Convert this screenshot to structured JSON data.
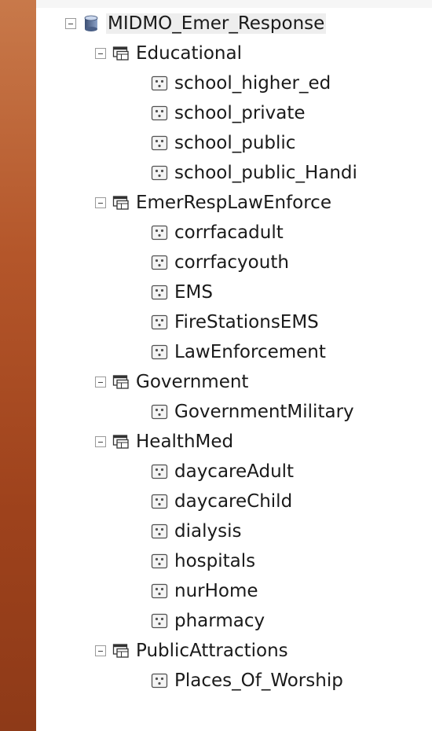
{
  "tree": {
    "root": {
      "label": "MIDMO_Emer_Response",
      "icon": "database-icon"
    },
    "datasets": [
      {
        "label": "Educational",
        "icon": "feature-dataset-icon",
        "classes": [
          "school_higher_ed",
          "school_private",
          "school_public",
          "school_public_Handi"
        ]
      },
      {
        "label": "EmerRespLawEnforce",
        "icon": "feature-dataset-icon",
        "classes": [
          "corrfacadult",
          "corrfacyouth",
          "EMS",
          "FireStationsEMS",
          "LawEnforcement"
        ]
      },
      {
        "label": "Government",
        "icon": "feature-dataset-icon",
        "classes": [
          "GovernmentMilitary"
        ]
      },
      {
        "label": "HealthMed",
        "icon": "feature-dataset-icon",
        "classes": [
          "daycareAdult",
          "daycareChild",
          "dialysis",
          "hospitals",
          "nurHome",
          "pharmacy"
        ]
      },
      {
        "label": "PublicAttractions",
        "icon": "feature-dataset-icon",
        "classes": [
          "Places_Of_Worship"
        ]
      }
    ],
    "feature_class_icon": "point-feature-class-icon",
    "expander_icon": "collapse-minus-icon"
  }
}
